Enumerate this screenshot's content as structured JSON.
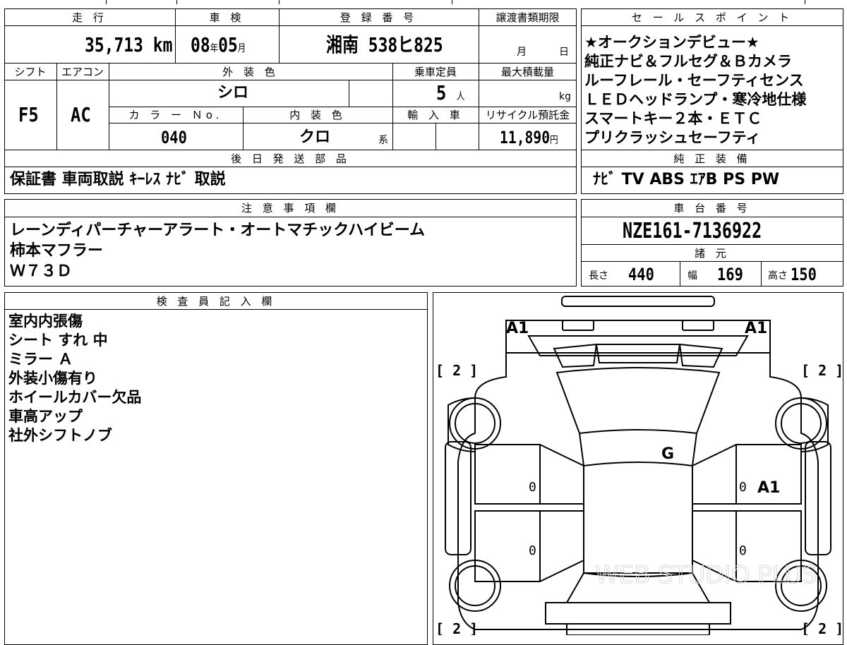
{
  "top": {
    "mileage_label": "走 行",
    "mileage_value": "35,713",
    "mileage_unit": "km",
    "inspection_label": "車 検",
    "inspection_year": "08",
    "inspection_year_unit": "年",
    "inspection_month": "05",
    "inspection_month_unit": "月",
    "registration_label": "登 録 番 号",
    "registration_value": "湘南 538ヒ825",
    "transfer_deadline_label": "譲渡書類期限",
    "transfer_month_unit": "月",
    "transfer_day_unit": "日"
  },
  "spec": {
    "shift_label": "シフト",
    "shift_value": "F5",
    "ac_label": "エアコン",
    "ac_value": "AC",
    "exterior_color_label": "外 装 色",
    "exterior_color_value": "シロ",
    "capacity_label": "乗車定員",
    "capacity_value": "5",
    "capacity_unit": "人",
    "max_load_label": "最大積載量",
    "max_load_unit": "kg",
    "color_no_label": "カ ラ ー Ｎo.",
    "color_no_value": "040",
    "interior_color_label": "内 装 色",
    "interior_color_value": "クロ",
    "interior_suffix": "系",
    "import_label": "輸 入 車",
    "recycle_label": "リサイクル預託金",
    "recycle_value": "11,890",
    "recycle_unit": "円"
  },
  "later_parts": {
    "label": "後 日 発 送 部 品",
    "value": "保証書  車両取説  ｷｰﾚｽ  ﾅﾋﾞ 取説"
  },
  "sales_points": {
    "label": "セ ー ル ス ポ イ ン ト",
    "lines": [
      "★オークションデビュー★",
      "純正ナビ＆フルセグ＆Ｂカメラ",
      "ルーフレール・セーフティセンス",
      "ＬＥＤヘッドランプ・寒冷地仕様",
      "スマートキー２本・ＥＴＣ",
      "プリクラッシュセーフティ"
    ]
  },
  "genuine_equipment": {
    "label": "純 正 装 備",
    "value": "ﾅﾋﾞ  TV  ABS  ｴｱB  PS  PW"
  },
  "notes": {
    "label": "注 意 事 項 欄",
    "lines": [
      "レーンディパーチャーアラート・オートマチックハイビーム",
      "柿本マフラー",
      "Ｗ７３Ｄ"
    ]
  },
  "chassis": {
    "label": "車 台 番 号",
    "value": "NZE161-7136922"
  },
  "dimensions": {
    "label": "諸 元",
    "length_label": "長さ",
    "length_value": "440",
    "width_label": "幅",
    "width_value": "169",
    "height_label": "高さ",
    "height_value": "150"
  },
  "inspector": {
    "label": "検 査 員 記 入 欄",
    "lines": [
      "室内内張傷",
      "シート すれ 中",
      "ミラー Ａ",
      "外装小傷有り",
      "ホイールカバー欠品",
      "車高アップ",
      "社外シフトノブ"
    ]
  },
  "diagram": {
    "marks": {
      "front_left": "A1",
      "front_right": "A1",
      "windshield": "G",
      "right_front_door": "A1",
      "door_zero_1": "0",
      "door_zero_2": "0",
      "door_zero_3": "0",
      "door_zero_4": "0",
      "tire_fl": "[ 2 ]",
      "tire_fr": "[ 2 ]",
      "tire_rl": "[ 2 ]",
      "tire_rr": "[ 2 ]"
    },
    "watermark": "WEB STUDIO PLUS"
  },
  "colors": {
    "line": "#000000",
    "background": "#ffffff",
    "watermark": "#d9d9d9"
  }
}
